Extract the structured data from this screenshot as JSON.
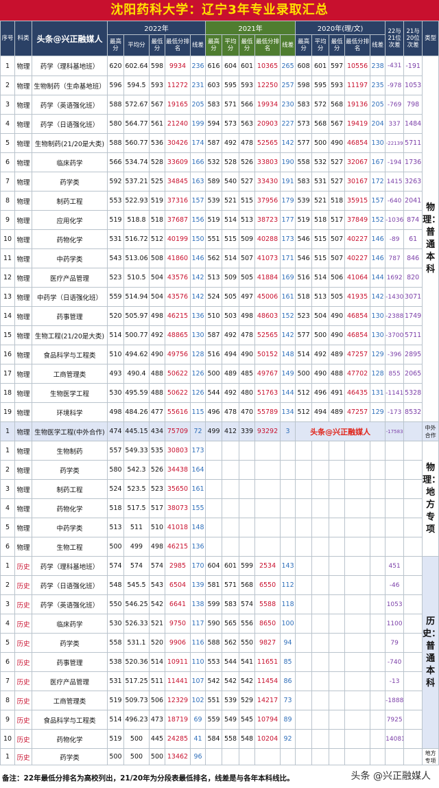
{
  "title": "沈阳药科大学：辽宁3年专业录取汇总",
  "header": {
    "seq": "序号",
    "subject": "科类",
    "watermark": "头条@兴正融媒人",
    "y2022": "2022年",
    "y2021": "2021年",
    "y2020": "2020年(理/文)",
    "d1": "22与21位次差",
    "d2": "21与20位次差",
    "type": "类型",
    "sub": {
      "max": "最高分",
      "avg": "平均分",
      "min": "最低分",
      "rank": "最低分排名",
      "xc": "线差"
    }
  },
  "categories": {
    "phys_regular": "物理：普通本科",
    "coop": "中外合作",
    "phys_local": "物理：地方专项",
    "hist_regular": "历史：普通本科",
    "hist_local": "地方专项"
  },
  "coop_watermark": "头条@兴正融媒人",
  "footnote": "备注：22年最低分排名为高校列出，21/20年为分段表最低排名，线差是与各年本科线比。",
  "corner_watermark": "头条 @兴正融媒人",
  "rows": [
    {
      "seq": "1",
      "subject": "物理",
      "major": "药学（理科基地班）",
      "y22": [
        "620",
        "602.64",
        "598",
        "9934",
        "236"
      ],
      "y21": [
        "616",
        "604",
        "601",
        "10365",
        "265"
      ],
      "y20": [
        "608",
        "601",
        "597",
        "10556",
        "238"
      ],
      "d1": "-431",
      "d2": "-191"
    },
    {
      "seq": "2",
      "subject": "物理",
      "major": "生物制药（生命基地班）",
      "y22": [
        "596",
        "594.5",
        "593",
        "11272",
        "231"
      ],
      "y21": [
        "603",
        "595",
        "593",
        "12250",
        "257"
      ],
      "y20": [
        "598",
        "595",
        "593",
        "11197",
        "235"
      ],
      "d1": "-978",
      "d2": "1053"
    },
    {
      "seq": "3",
      "subject": "物理",
      "major": "药学（英语强化班）",
      "y22": [
        "588",
        "572.67",
        "567",
        "19165",
        "205"
      ],
      "y21": [
        "583",
        "571",
        "566",
        "19934",
        "230"
      ],
      "y20": [
        "583",
        "572",
        "568",
        "19136",
        "205"
      ],
      "d1": "-769",
      "d2": "798"
    },
    {
      "seq": "4",
      "subject": "物理",
      "major": "药学（日语强化班）",
      "y22": [
        "580",
        "564.77",
        "561",
        "21240",
        "199"
      ],
      "y21": [
        "594",
        "573",
        "563",
        "20903",
        "227"
      ],
      "y20": [
        "573",
        "568",
        "567",
        "19419",
        "204"
      ],
      "d1": "337",
      "d2": "1484"
    },
    {
      "seq": "5",
      "subject": "物理",
      "major": "生物制药(21/20是大类)",
      "y22": [
        "588",
        "560.77",
        "536",
        "30426",
        "174"
      ],
      "y21": [
        "587",
        "492",
        "478",
        "52565",
        "142"
      ],
      "y20": [
        "577",
        "500",
        "490",
        "46854",
        "130"
      ],
      "d1": "-22139",
      "d2": "5711"
    },
    {
      "seq": "6",
      "subject": "物理",
      "major": "临床药学",
      "y22": [
        "566",
        "534.74",
        "528",
        "33609",
        "166"
      ],
      "y21": [
        "532",
        "528",
        "526",
        "33803",
        "190"
      ],
      "y20": [
        "558",
        "532",
        "527",
        "32067",
        "167"
      ],
      "d1": "-194",
      "d2": "1736"
    },
    {
      "seq": "7",
      "subject": "物理",
      "major": "药学类",
      "y22": [
        "592",
        "537.21",
        "525",
        "34845",
        "163"
      ],
      "y21": [
        "589",
        "540",
        "527",
        "33430",
        "191"
      ],
      "y20": [
        "583",
        "531",
        "527",
        "30167",
        "172"
      ],
      "d1": "1415",
      "d2": "3263"
    },
    {
      "seq": "8",
      "subject": "物理",
      "major": "制药工程",
      "y22": [
        "553",
        "522.93",
        "519",
        "37316",
        "157"
      ],
      "y21": [
        "539",
        "521",
        "515",
        "37956",
        "179"
      ],
      "y20": [
        "539",
        "521",
        "518",
        "35915",
        "157"
      ],
      "d1": "-640",
      "d2": "2041"
    },
    {
      "seq": "9",
      "subject": "物理",
      "major": "应用化学",
      "y22": [
        "519",
        "518.8",
        "518",
        "37687",
        "156"
      ],
      "y21": [
        "519",
        "514",
        "513",
        "38723",
        "177"
      ],
      "y20": [
        "519",
        "518",
        "517",
        "37849",
        "152"
      ],
      "d1": "-1036",
      "d2": "874"
    },
    {
      "seq": "10",
      "subject": "物理",
      "major": "药物化学",
      "y22": [
        "531",
        "516.72",
        "512",
        "40199",
        "150"
      ],
      "y21": [
        "551",
        "515",
        "509",
        "40288",
        "173"
      ],
      "y20": [
        "546",
        "515",
        "507",
        "40227",
        "146"
      ],
      "d1": "-89",
      "d2": "61"
    },
    {
      "seq": "11",
      "subject": "物理",
      "major": "中药学类",
      "y22": [
        "543",
        "513.06",
        "508",
        "41860",
        "146"
      ],
      "y21": [
        "562",
        "514",
        "507",
        "41073",
        "171"
      ],
      "y20": [
        "546",
        "515",
        "507",
        "40227",
        "146"
      ],
      "d1": "787",
      "d2": "846"
    },
    {
      "seq": "12",
      "subject": "物理",
      "major": "医疗产品管理",
      "y22": [
        "523",
        "510.5",
        "504",
        "43576",
        "142"
      ],
      "y21": [
        "513",
        "509",
        "505",
        "41884",
        "169"
      ],
      "y20": [
        "516",
        "514",
        "506",
        "41064",
        "144"
      ],
      "d1": "1692",
      "d2": "820"
    },
    {
      "seq": "13",
      "subject": "物理",
      "major": "中药学（日语强化班）",
      "y22": [
        "559",
        "514.94",
        "504",
        "43576",
        "142"
      ],
      "y21": [
        "524",
        "505",
        "497",
        "45006",
        "161"
      ],
      "y20": [
        "518",
        "513",
        "505",
        "41935",
        "142"
      ],
      "d1": "-1430",
      "d2": "3071"
    },
    {
      "seq": "14",
      "subject": "物理",
      "major": "药事管理",
      "y22": [
        "520",
        "505.97",
        "498",
        "46215",
        "136"
      ],
      "y21": [
        "510",
        "503",
        "498",
        "48603",
        "152"
      ],
      "y20": [
        "523",
        "504",
        "490",
        "46854",
        "130"
      ],
      "d1": "-2388",
      "d2": "1749"
    },
    {
      "seq": "15",
      "subject": "物理",
      "major": "生物工程(21/20是大类)",
      "y22": [
        "514",
        "500.77",
        "492",
        "48865",
        "130"
      ],
      "y21": [
        "587",
        "492",
        "478",
        "52565",
        "142"
      ],
      "y20": [
        "577",
        "500",
        "490",
        "46854",
        "130"
      ],
      "d1": "-3700",
      "d2": "5711"
    },
    {
      "seq": "16",
      "subject": "物理",
      "major": "食品科学与工程类",
      "y22": [
        "510",
        "494.62",
        "490",
        "49756",
        "128"
      ],
      "y21": [
        "516",
        "494",
        "490",
        "50152",
        "148"
      ],
      "y20": [
        "514",
        "492",
        "489",
        "47257",
        "129"
      ],
      "d1": "-396",
      "d2": "2895"
    },
    {
      "seq": "17",
      "subject": "物理",
      "major": "工商管理类",
      "y22": [
        "493",
        "490.4",
        "488",
        "50622",
        "126"
      ],
      "y21": [
        "500",
        "489",
        "485",
        "49767",
        "149"
      ],
      "y20": [
        "500",
        "490",
        "488",
        "47702",
        "128"
      ],
      "d1": "855",
      "d2": "2065"
    },
    {
      "seq": "18",
      "subject": "物理",
      "major": "生物医学工程",
      "y22": [
        "530",
        "495.59",
        "488",
        "50622",
        "126"
      ],
      "y21": [
        "544",
        "492",
        "480",
        "51763",
        "144"
      ],
      "y20": [
        "512",
        "496",
        "491",
        "46435",
        "131"
      ],
      "d1": "-1141",
      "d2": "5328"
    },
    {
      "seq": "19",
      "subject": "物理",
      "major": "环境科学",
      "y22": [
        "498",
        "484.26",
        "477",
        "55616",
        "115"
      ],
      "y21": [
        "496",
        "478",
        "470",
        "55789",
        "134"
      ],
      "y20": [
        "512",
        "494",
        "489",
        "47257",
        "129"
      ],
      "d1": "-173",
      "d2": "8532"
    }
  ],
  "coop_row": {
    "seq": "1",
    "subject": "物理",
    "major": "生物医学工程(中外合作)",
    "y22": [
      "474",
      "445.15",
      "434",
      "75709",
      "72"
    ],
    "y21": [
      "499",
      "412",
      "339",
      "93292",
      "3"
    ],
    "d1": "-17583"
  },
  "local_rows": [
    {
      "seq": "1",
      "subject": "物理",
      "major": "生物制药",
      "y22": [
        "557",
        "549.33",
        "535",
        "30803",
        "173"
      ]
    },
    {
      "seq": "2",
      "subject": "物理",
      "major": "药学类",
      "y22": [
        "580",
        "542.3",
        "526",
        "34438",
        "164"
      ]
    },
    {
      "seq": "3",
      "subject": "物理",
      "major": "制药工程",
      "y22": [
        "524",
        "523.5",
        "523",
        "35650",
        "161"
      ]
    },
    {
      "seq": "4",
      "subject": "物理",
      "major": "药物化学",
      "y22": [
        "518",
        "517.5",
        "517",
        "38073",
        "155"
      ]
    },
    {
      "seq": "5",
      "subject": "物理",
      "major": "中药学类",
      "y22": [
        "513",
        "511",
        "510",
        "41018",
        "148"
      ]
    },
    {
      "seq": "6",
      "subject": "物理",
      "major": "生物工程",
      "y22": [
        "500",
        "499",
        "498",
        "46215",
        "136"
      ]
    }
  ],
  "hist_rows": [
    {
      "seq": "1",
      "subject": "历史",
      "major": "药学（理科基地班）",
      "y22": [
        "574",
        "574",
        "574",
        "2985",
        "170"
      ],
      "y21": [
        "604",
        "601",
        "599",
        "2534",
        "143"
      ],
      "d1": "451"
    },
    {
      "seq": "2",
      "subject": "历史",
      "major": "药学（日语强化班）",
      "y22": [
        "548",
        "545.5",
        "543",
        "6504",
        "139"
      ],
      "y21": [
        "581",
        "571",
        "568",
        "6550",
        "112"
      ],
      "d1": "-46"
    },
    {
      "seq": "3",
      "subject": "历史",
      "major": "药学（英语强化班）",
      "y22": [
        "550",
        "546.25",
        "542",
        "6641",
        "138"
      ],
      "y21": [
        "599",
        "583",
        "574",
        "5588",
        "118"
      ],
      "d1": "1053"
    },
    {
      "seq": "4",
      "subject": "历史",
      "major": "临床药学",
      "y22": [
        "530",
        "526.33",
        "521",
        "9750",
        "117"
      ],
      "y21": [
        "590",
        "565",
        "556",
        "8650",
        "100"
      ],
      "d1": "1100"
    },
    {
      "seq": "5",
      "subject": "历史",
      "major": "药学类",
      "y22": [
        "558",
        "531.1",
        "520",
        "9906",
        "116"
      ],
      "y21": [
        "588",
        "562",
        "550",
        "9827",
        "94"
      ],
      "d1": "79"
    },
    {
      "seq": "6",
      "subject": "历史",
      "major": "药事管理",
      "y22": [
        "538",
        "520.36",
        "514",
        "10911",
        "110"
      ],
      "y21": [
        "553",
        "544",
        "541",
        "11651",
        "85"
      ],
      "d1": "-740"
    },
    {
      "seq": "7",
      "subject": "历史",
      "major": "医疗产品管理",
      "y22": [
        "531",
        "517.25",
        "511",
        "11441",
        "107"
      ],
      "y21": [
        "542",
        "542",
        "542",
        "11454",
        "86"
      ],
      "d1": "-13"
    },
    {
      "seq": "8",
      "subject": "历史",
      "major": "工商管理类",
      "y22": [
        "519",
        "509.73",
        "506",
        "12329",
        "102"
      ],
      "y21": [
        "551",
        "539",
        "529",
        "14217",
        "73"
      ],
      "d1": "-1888"
    },
    {
      "seq": "9",
      "subject": "历史",
      "major": "食品科学与工程类",
      "y22": [
        "514",
        "496.23",
        "473",
        "18719",
        "69"
      ],
      "y21": [
        "559",
        "549",
        "545",
        "10794",
        "89"
      ],
      "d1": "7925"
    },
    {
      "seq": "10",
      "subject": "历史",
      "major": "药物化学",
      "y22": [
        "519",
        "500",
        "445",
        "24285",
        "41"
      ],
      "y21": [
        "584",
        "558",
        "548",
        "10204",
        "92"
      ],
      "d1": "14081"
    }
  ],
  "hist_local_row": {
    "seq": "1",
    "subject": "历史",
    "major": "药学类",
    "y22": [
      "500",
      "500",
      "500",
      "13462",
      "96"
    ]
  }
}
